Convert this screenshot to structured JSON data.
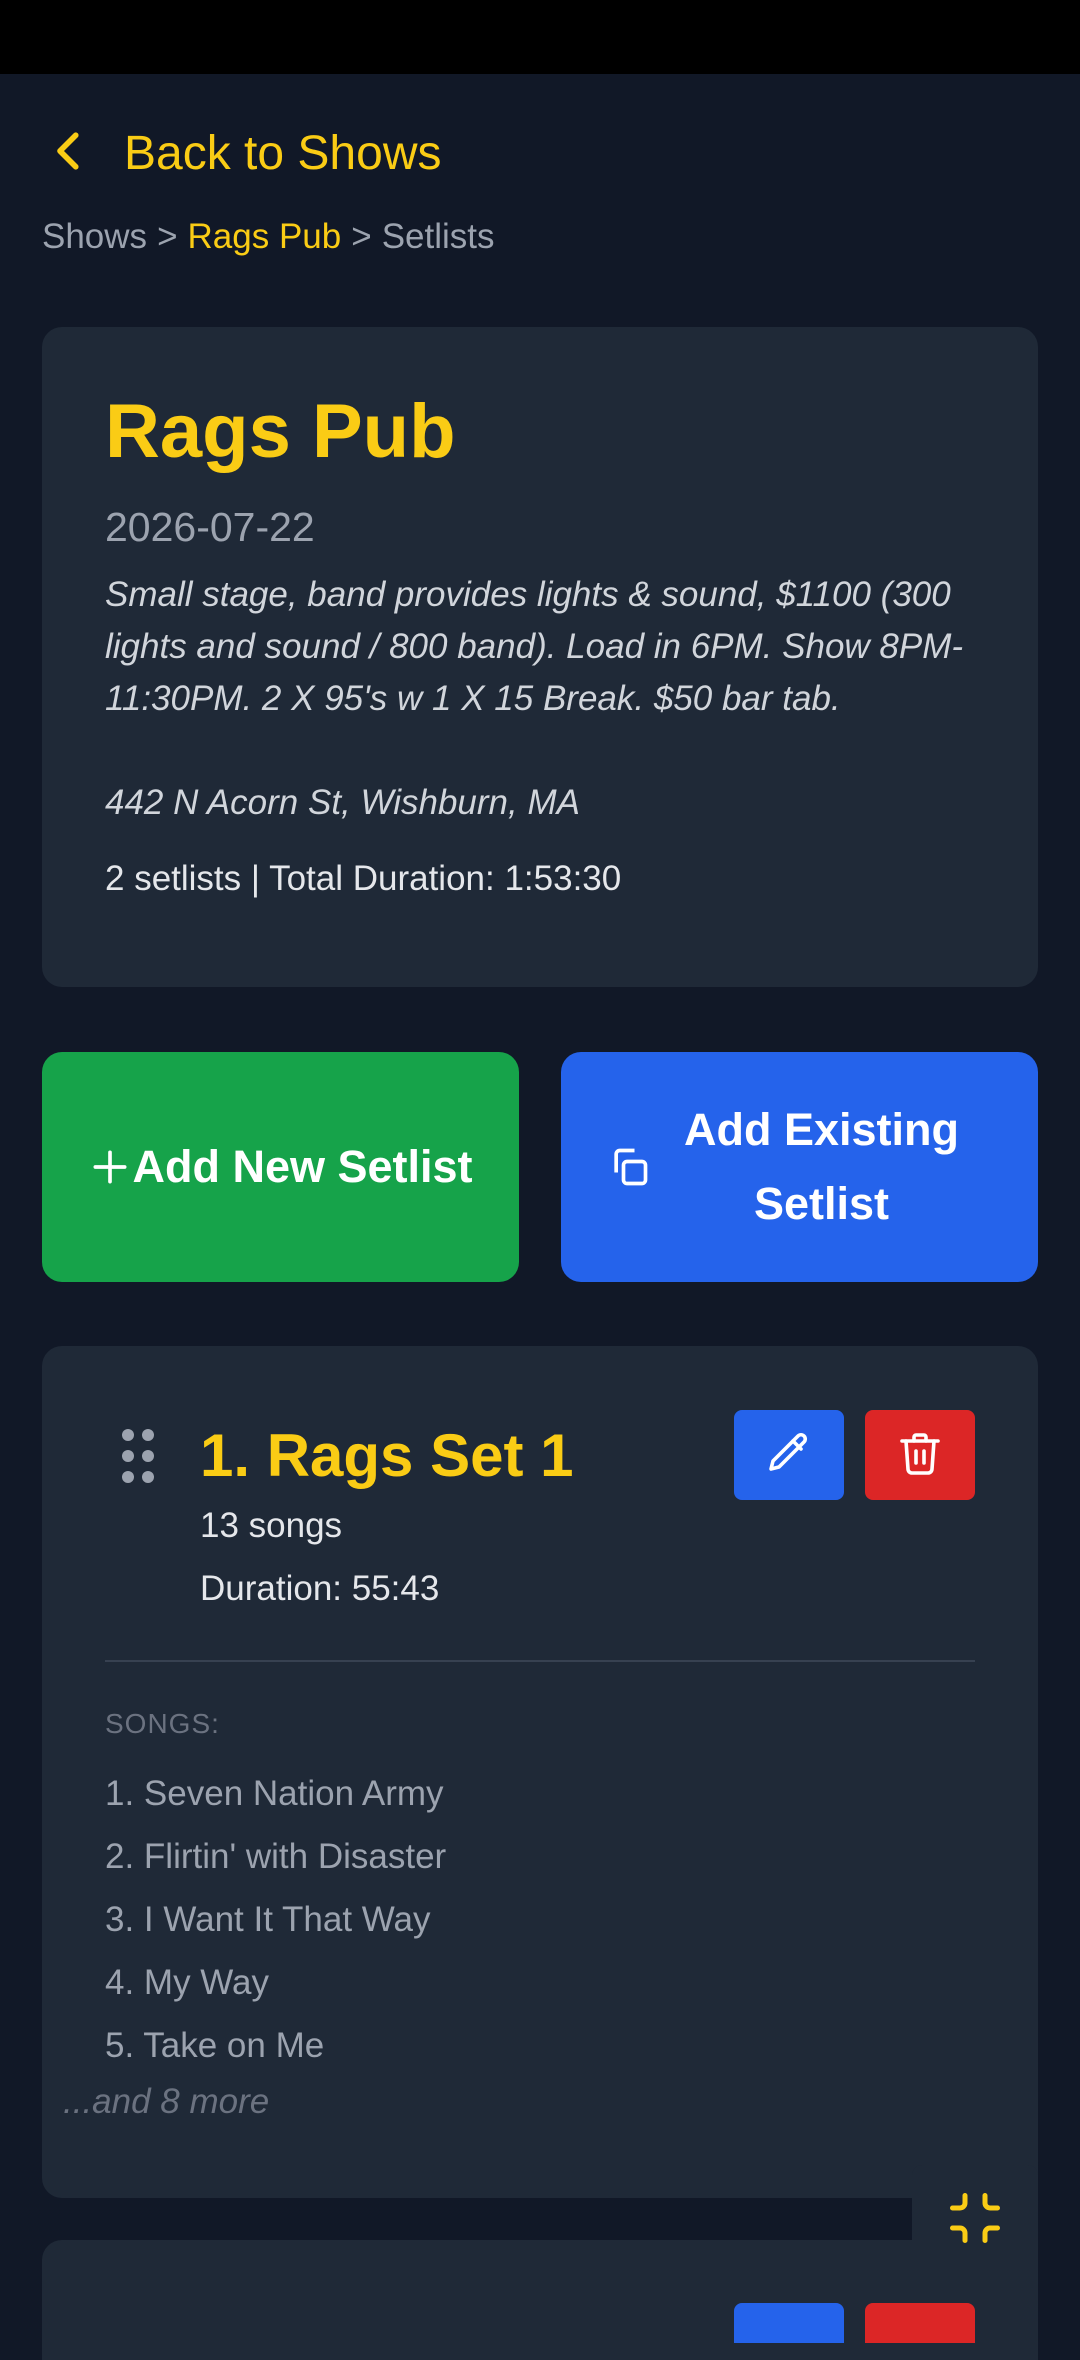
{
  "colors": {
    "accent": "#facc15",
    "background": "#111827",
    "card": "#1f2937",
    "green_button": "#16a34a",
    "blue_button": "#2563eb",
    "red_button": "#dc2626"
  },
  "nav": {
    "back_label": "Back to Shows",
    "back_icon": "chevron-left-icon"
  },
  "breadcrumb": {
    "items": [
      "Shows",
      "Rags Pub",
      "Setlists"
    ],
    "separator": ">"
  },
  "show": {
    "title": "Rags Pub",
    "date": "2026-07-22",
    "notes": "Small stage, band provides lights & sound, $1100 (300 lights and sound / 800 band). Load in 6PM. Show 8PM-11:30PM. 2 X 95's w 1 X 15 Break. $50 bar tab.",
    "address": "442 N Acorn St, Wishburn, MA",
    "summary": "2 setlists | Total Duration: 1:53:30"
  },
  "actions": {
    "add_new_label": "Add New Setlist",
    "add_new_icon": "plus-icon",
    "add_existing_label": "Add Existing Setlist",
    "add_existing_icon": "copy-icon"
  },
  "setlists": [
    {
      "title": "1. Rags Set 1",
      "song_count": "13 songs",
      "duration": "Duration: 55:43",
      "songs_heading": "SONGS:",
      "songs": [
        "1. Seven Nation Army",
        "2. Flirtin' with Disaster",
        "3. I Want It That Way",
        "4. My Way",
        "5. Take on Me"
      ],
      "more": "...and 8 more",
      "icons": [
        "drag-handle-icon",
        "pencil-icon",
        "trash-icon"
      ]
    }
  ],
  "fab": {
    "icon": "collapse-icon"
  }
}
